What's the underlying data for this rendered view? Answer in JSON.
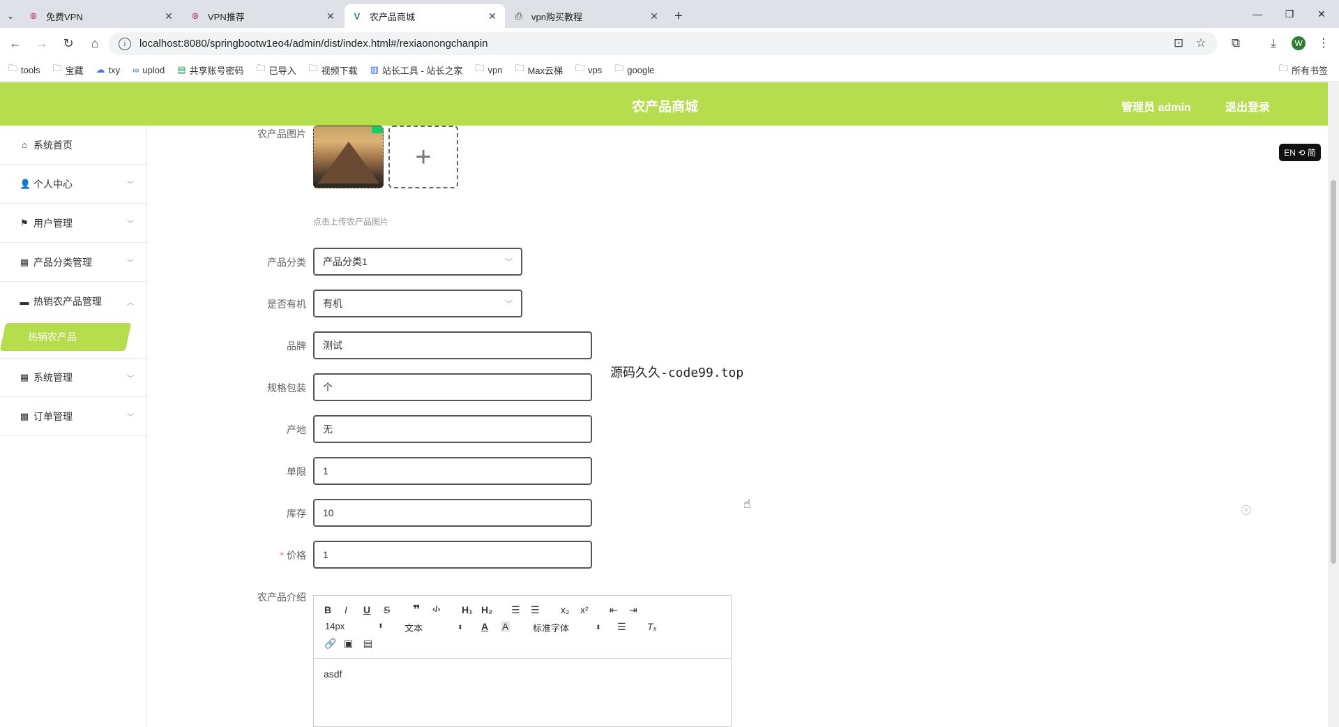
{
  "browser": {
    "tabs": [
      {
        "title": "免费VPN",
        "icon": "vpn-app-icon"
      },
      {
        "title": "VPN推荐",
        "icon": "vpn-app-icon"
      },
      {
        "title": "农产品商城",
        "icon": "vue-icon"
      },
      {
        "title": "vpn购买教程",
        "icon": "article-icon"
      }
    ],
    "url": "localhost:8080/springbootw1eo4/admin/dist/index.html#/rexiaonongchanpin",
    "profile_initial": "W",
    "bookmarks": [
      "tools",
      "宝藏",
      "txy",
      "uplod",
      "共享账号密码",
      "已导入",
      "视频下载",
      "站长工具 - 站长之家",
      "vpn",
      "Max云梯",
      "vps",
      "google"
    ],
    "all_bookmarks": "所有书签"
  },
  "header": {
    "title": "农产品商城",
    "admin": "管理员 admin",
    "logout": "退出登录"
  },
  "sidebar": {
    "items": [
      {
        "label": "系统首页",
        "icon": "home-icon"
      },
      {
        "label": "个人中心",
        "icon": "user-icon"
      },
      {
        "label": "用户管理",
        "icon": "flag-icon"
      },
      {
        "label": "产品分类管理",
        "icon": "grid-icon"
      },
      {
        "label": "热销农产品管理",
        "icon": "chat-icon"
      },
      {
        "label": "系统管理",
        "icon": "grid-icon"
      },
      {
        "label": "订单管理",
        "icon": "apps-icon"
      }
    ],
    "active_sub": "热销农产品"
  },
  "form": {
    "image_label": "农产品图片",
    "image_hint": "点击上传农产品图片",
    "category_label": "产品分类",
    "category_value": "产品分类1",
    "organic_label": "是否有机",
    "organic_value": "有机",
    "brand_label": "品牌",
    "brand_value": "测试",
    "spec_label": "规格包装",
    "spec_value": "个",
    "origin_label": "产地",
    "origin_value": "无",
    "limit_label": "单限",
    "limit_value": "1",
    "stock_label": "库存",
    "stock_value": "10",
    "price_label": "价格",
    "price_value": "1",
    "intro_label": "农产品介绍"
  },
  "editor": {
    "size": "14px",
    "header": "文本",
    "font": "标准字体",
    "content": "asdf"
  },
  "overlay": {
    "watermark": "源码久久-code99.top",
    "lang": "EN ⟲ 简"
  }
}
